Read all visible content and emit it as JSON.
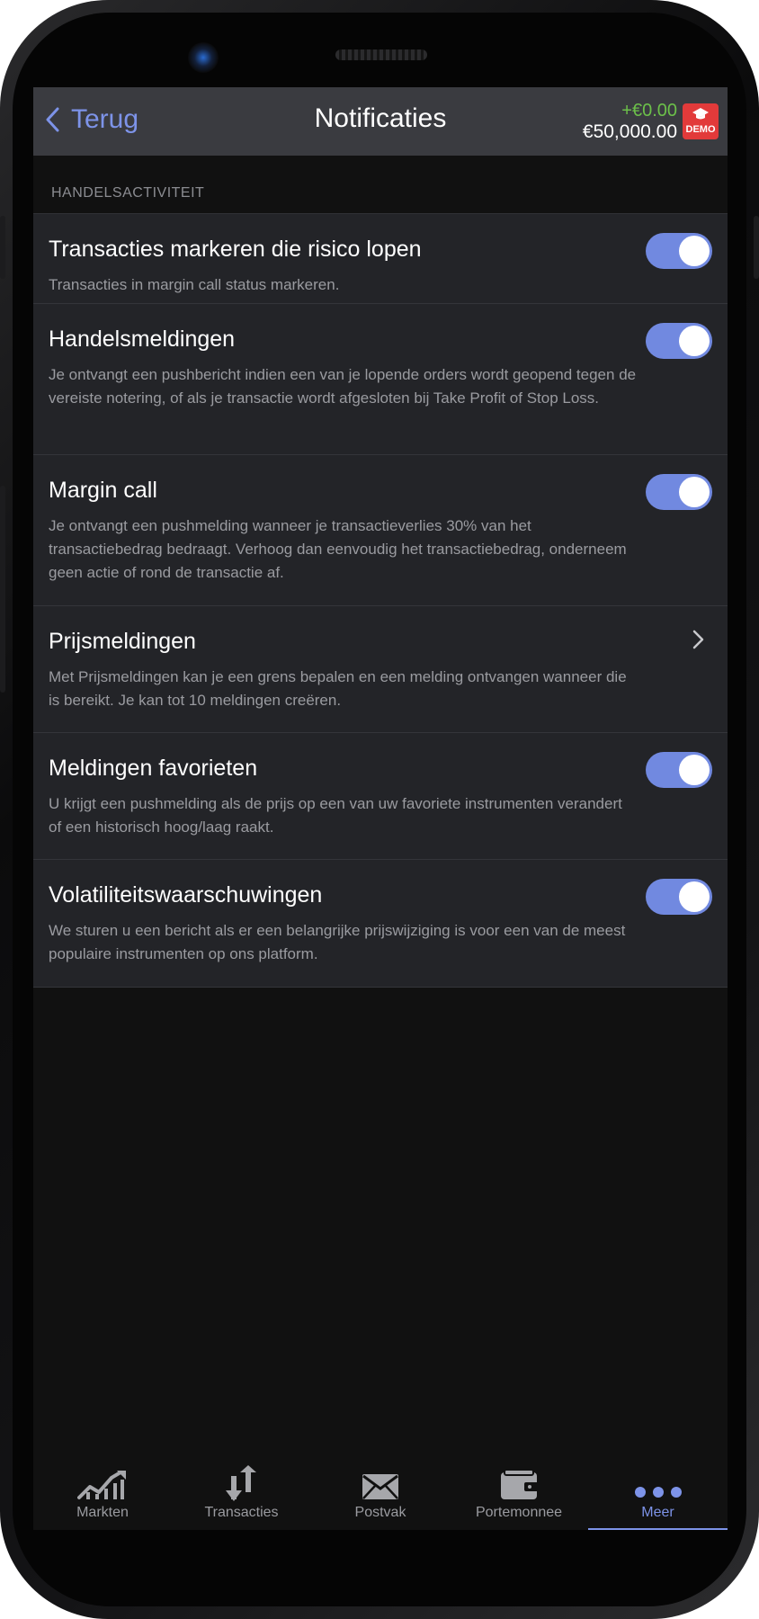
{
  "header": {
    "back_label": "Terug",
    "title": "Notificaties",
    "balance_delta": "+€0.00",
    "balance_total": "€50,000.00",
    "badge": "DEMO"
  },
  "section": {
    "label": "HANDELSACTIVITEIT"
  },
  "items": [
    {
      "title": "Transacties markeren die risico lopen",
      "description": "Transacties in margin call status markeren.",
      "control": "toggle",
      "enabled": true
    },
    {
      "title": "Handelsmeldingen",
      "description": "Je ontvangt een pushbericht indien een van je lopende orders wordt geopend tegen de vereiste notering, of als je transactie wordt afgesloten bij Take Profit of Stop Loss.",
      "control": "toggle",
      "enabled": true
    },
    {
      "title": "Margin call",
      "description": "Je ontvangt een pushmelding wanneer je transactieverlies 30% van het transactiebedrag bedraagt. Verhoog dan eenvoudig het transactiebedrag, onderneem geen actie of rond de transactie af.",
      "control": "toggle",
      "enabled": true
    },
    {
      "title": "Prijsmeldingen",
      "description": "Met Prijsmeldingen kan je een grens bepalen en een melding ontvangen wanneer die is bereikt. Je kan tot 10 meldingen creëren.",
      "control": "chevron"
    },
    {
      "title": "Meldingen favorieten",
      "description": "U krijgt een pushmelding als de prijs op een van uw favoriete instrumenten verandert of een historisch hoog/laag raakt.",
      "control": "toggle",
      "enabled": true
    },
    {
      "title": "Volatiliteitswaarschuwingen",
      "description": "We sturen u een bericht als er een belangrijke prijswijziging is voor een van de meest populaire instrumenten op ons platform.",
      "control": "toggle",
      "enabled": true
    }
  ],
  "tabs": [
    {
      "label": "Markten",
      "icon": "chart-icon",
      "active": false
    },
    {
      "label": "Transacties",
      "icon": "transfer-arrows-icon",
      "active": false
    },
    {
      "label": "Postvak",
      "icon": "envelope-icon",
      "active": false
    },
    {
      "label": "Portemonnee",
      "icon": "wallet-icon",
      "active": false
    },
    {
      "label": "Meer",
      "icon": "more-dots-icon",
      "active": true
    }
  ],
  "colors": {
    "accent": "#7d93e8",
    "toggle_on": "#7189e0",
    "positive": "#6cc04a",
    "demo_badge": "#e23a3a"
  }
}
